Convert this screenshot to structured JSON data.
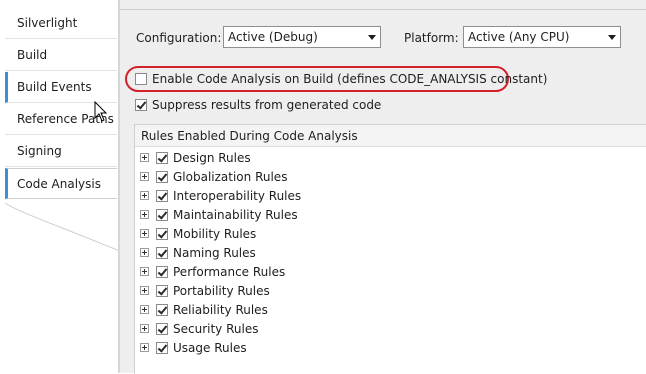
{
  "sidebar": {
    "tabs": [
      {
        "label": "Silverlight"
      },
      {
        "label": "Build"
      },
      {
        "label": "Build Events"
      },
      {
        "label": "Reference Paths"
      },
      {
        "label": "Signing"
      },
      {
        "label": "Code Analysis"
      }
    ],
    "selected": "Code Analysis"
  },
  "settings": {
    "configuration_label": "Configuration:",
    "configuration_value": "Active (Debug)",
    "platform_label": "Platform:",
    "platform_value": "Active (Any CPU)",
    "enable_code_analysis_label": "Enable Code Analysis on Build (defines CODE_ANALYSIS constant)",
    "enable_code_analysis_checked": false,
    "suppress_label": "Suppress results from generated code",
    "suppress_checked": true
  },
  "rules": {
    "header": "Rules Enabled During Code Analysis",
    "items": [
      {
        "label": "Design Rules",
        "checked": true
      },
      {
        "label": "Globalization Rules",
        "checked": true
      },
      {
        "label": "Interoperability Rules",
        "checked": true
      },
      {
        "label": "Maintainability Rules",
        "checked": true
      },
      {
        "label": "Mobility Rules",
        "checked": true
      },
      {
        "label": "Naming Rules",
        "checked": true
      },
      {
        "label": "Performance Rules",
        "checked": true
      },
      {
        "label": "Portability Rules",
        "checked": true
      },
      {
        "label": "Reliability Rules",
        "checked": true
      },
      {
        "label": "Security Rules",
        "checked": true
      },
      {
        "label": "Usage Rules",
        "checked": true
      }
    ]
  },
  "colors": {
    "accent": "#3a8fd6",
    "highlight_ring": "#d4202b"
  }
}
